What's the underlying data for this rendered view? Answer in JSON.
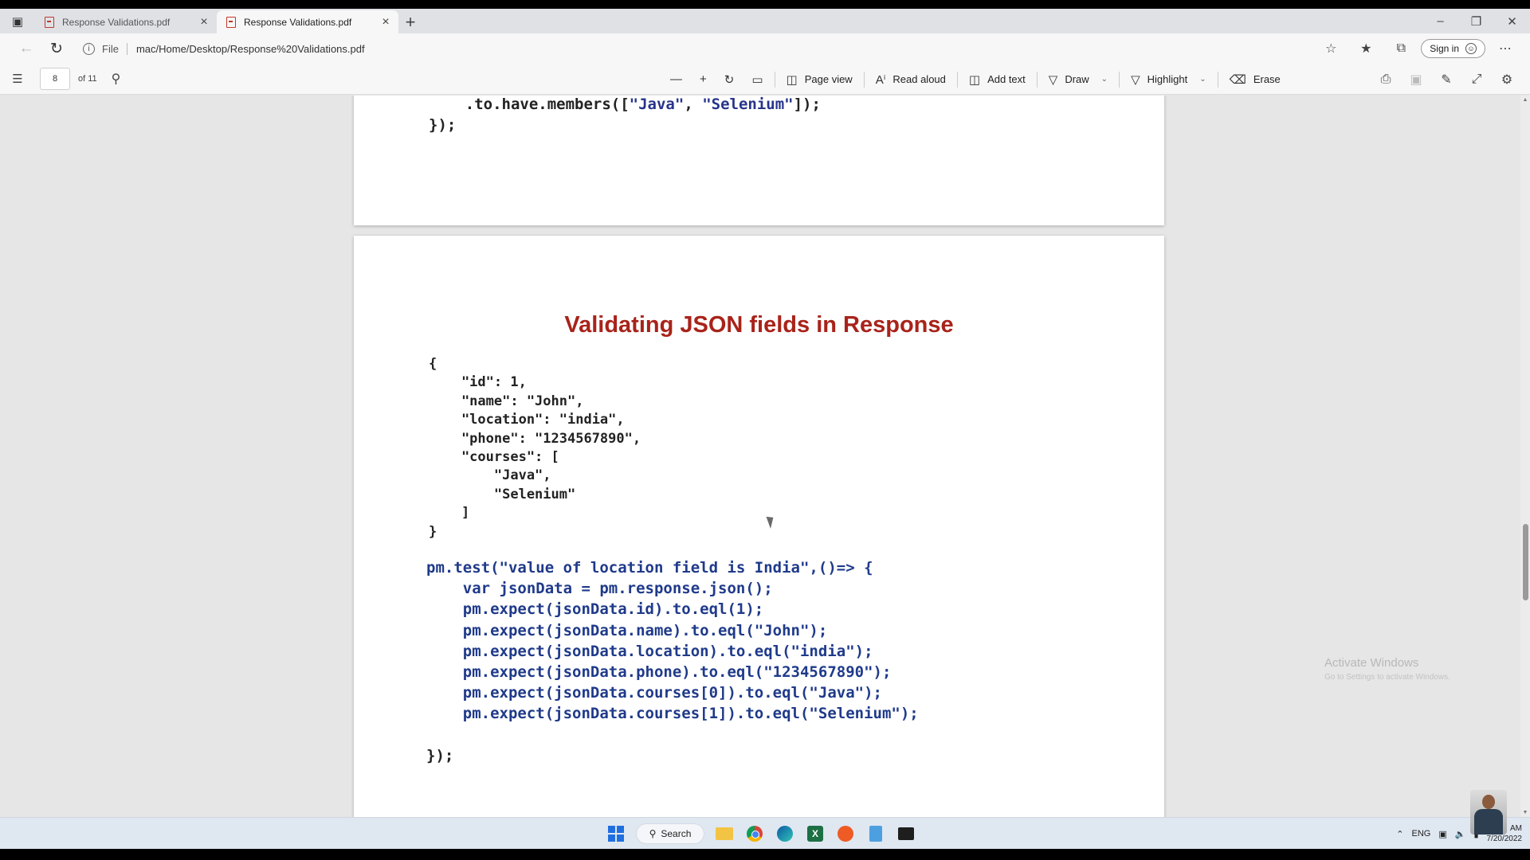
{
  "tabs": [
    {
      "label": "Response Validations.pdf",
      "active": false
    },
    {
      "label": "Response Validations.pdf",
      "active": true
    }
  ],
  "address": {
    "chip": "File",
    "url": "mac/Home/Desktop/Response%20Validations.pdf"
  },
  "signin": "Sign in",
  "pdf_toolbar": {
    "page_number": "8",
    "page_of": "of 11",
    "page_view": "Page view",
    "read_aloud": "Read aloud",
    "add_text": "Add text",
    "draw": "Draw",
    "highlight": "Highlight",
    "erase": "Erase"
  },
  "document": {
    "prev_page_lines": [
      ".to.have.members([\"Java\", \"Selenium\"]);",
      "});"
    ],
    "title": "Validating JSON fields in Response",
    "json_lines": [
      "{",
      "    \"id\": 1,",
      "    \"name\": \"John\",",
      "    \"location\": \"india\",",
      "    \"phone\": \"1234567890\",",
      "    \"courses\": [",
      "        \"Java\",",
      "        \"Selenium\"",
      "    ]",
      "}"
    ],
    "test_lines": [
      "pm.test(\"value of location field is India\",()=> {",
      "    var jsonData = pm.response.json();",
      "    pm.expect(jsonData.id).to.eql(1);",
      "    pm.expect(jsonData.name).to.eql(\"John\");",
      "    pm.expect(jsonData.location).to.eql(\"india\");",
      "    pm.expect(jsonData.phone).to.eql(\"1234567890\");",
      "    pm.expect(jsonData.courses[0]).to.eql(\"Java\");",
      "    pm.expect(jsonData.courses[1]).to.eql(\"Selenium\");",
      "",
      "});"
    ]
  },
  "watermark": {
    "line1": "Activate Windows",
    "line2": "Go to Settings to activate Windows."
  },
  "taskbar": {
    "search_label": "Search",
    "lang": "ENG",
    "time": "AM",
    "date": "7/20/2022"
  }
}
